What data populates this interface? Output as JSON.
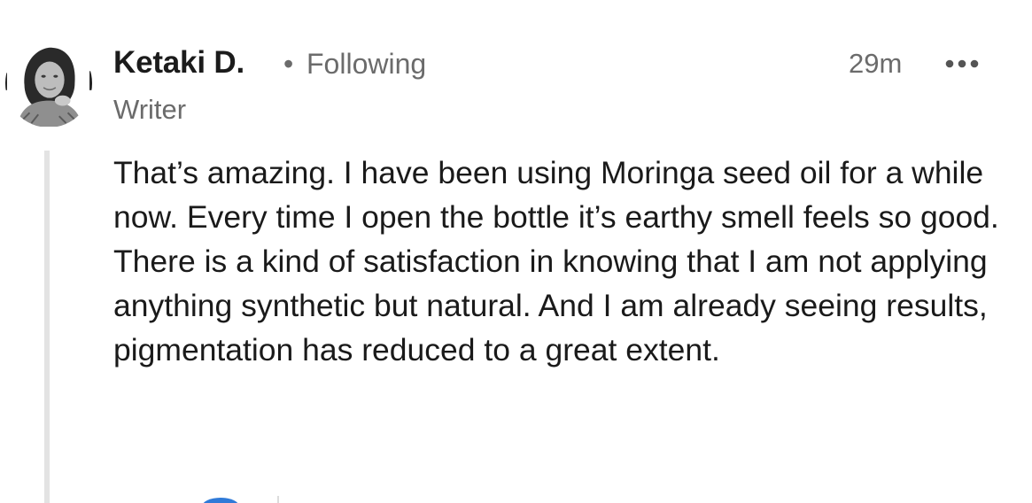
{
  "comment": {
    "author": {
      "name": "Ketaki D.",
      "separator": "•",
      "follow_status": "Following",
      "headline": "Writer"
    },
    "timestamp": "29m",
    "more_icon": "more-horizontal-icon",
    "body": "That’s amazing. I have been using Moringa seed oil for a while now. Every time I open the bottle it’s earthy smell feels so good. There is a kind of satisfaction in knowing that I am not applying anything synthetic but natural. And I am already seeing results, pigmentation has reduced to a great extent."
  },
  "colors": {
    "text_primary": "#1a1a1a",
    "text_secondary": "#6b6b6b",
    "thread_line": "#e3e3e3",
    "accent": "#2f7ad8"
  }
}
